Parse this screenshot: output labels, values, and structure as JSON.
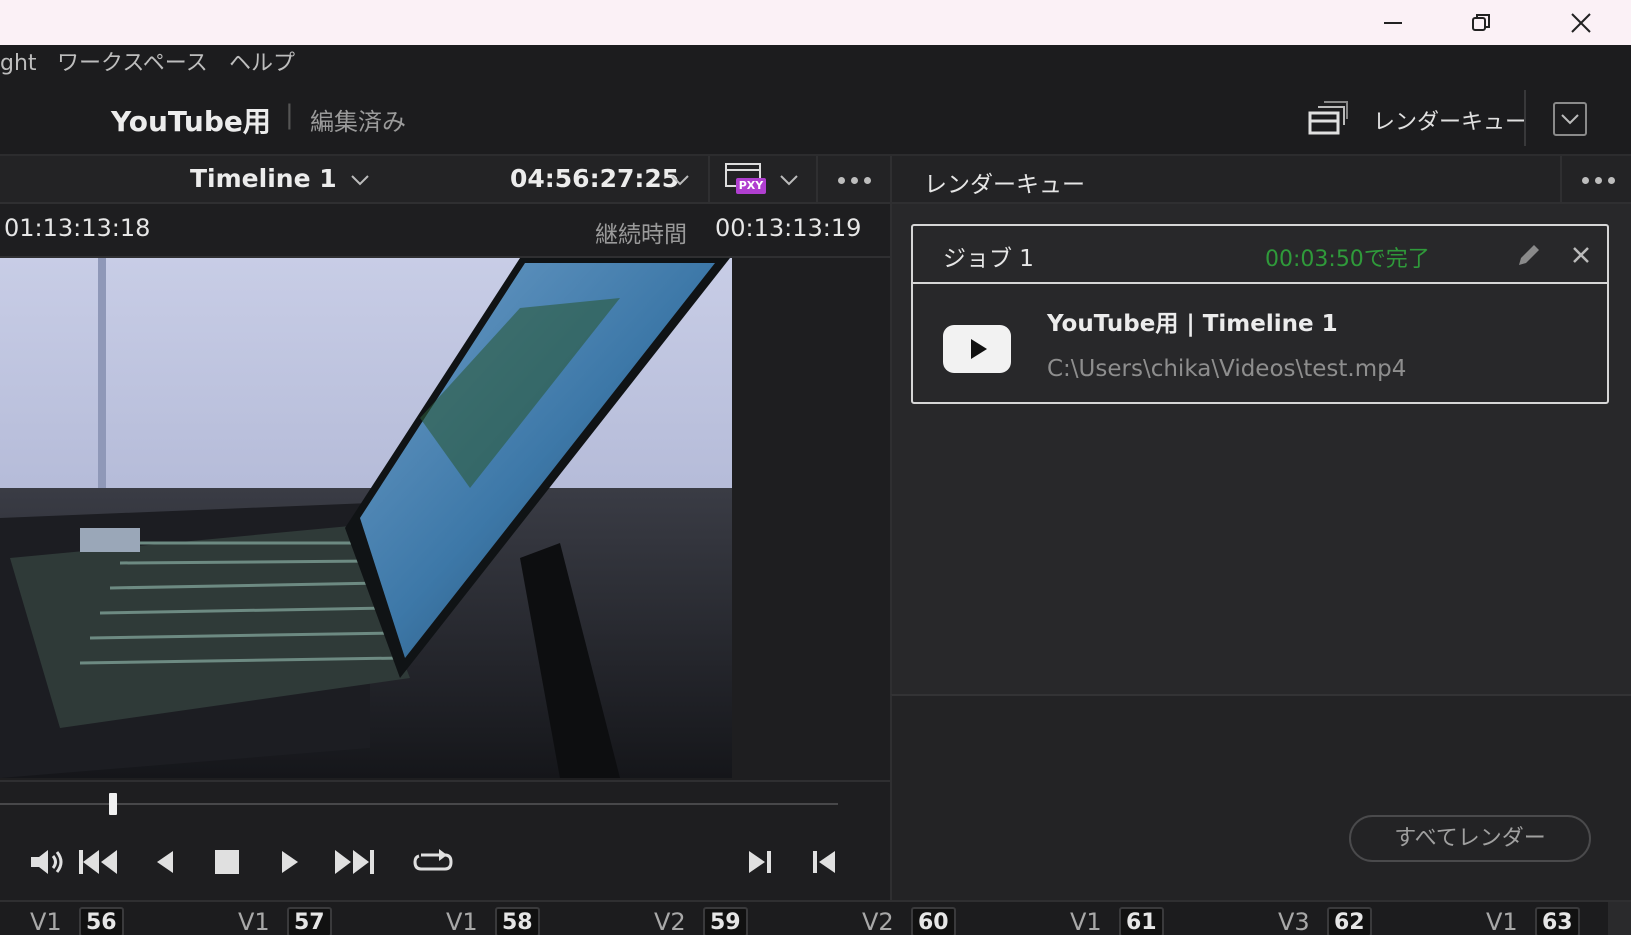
{
  "titlebar": {
    "minimize_icon": "minimize-icon",
    "restore_icon": "restore-icon",
    "close_icon": "close-icon"
  },
  "menu": {
    "items": [
      "ght",
      "ワークスペース",
      "ヘルプ"
    ]
  },
  "project": {
    "name": "YouTube用",
    "separator": "|",
    "status": "編集済み",
    "render_queue_label": "レンダーキュー"
  },
  "viewer": {
    "timeline_name": "Timeline 1",
    "timecode": "04:56:27:25",
    "proxy_badge": "PXY",
    "current_timecode": "01:13:13:18",
    "duration_label": "継続時間",
    "duration": "00:13:13:19"
  },
  "render_queue": {
    "title": "レンダーキュー",
    "job": {
      "name": "ジョブ 1",
      "status": "00:03:50で完了",
      "title": "YouTube用 | Timeline 1",
      "path": "C:\\Users\\chika\\Videos\\test.mp4"
    },
    "render_all_label": "すべてレンダー"
  },
  "scrubber": {
    "position": 0.13
  },
  "clips": [
    {
      "track": "V1",
      "num": "56"
    },
    {
      "track": "V1",
      "num": "57"
    },
    {
      "track": "V1",
      "num": "58"
    },
    {
      "track": "V2",
      "num": "59"
    },
    {
      "track": "V2",
      "num": "60"
    },
    {
      "track": "V1",
      "num": "61"
    },
    {
      "track": "V3",
      "num": "62"
    },
    {
      "track": "V1",
      "num": "63"
    }
  ],
  "colors": {
    "accent_green": "#2f9a3a",
    "proxy_purple": "#b03fd0"
  }
}
